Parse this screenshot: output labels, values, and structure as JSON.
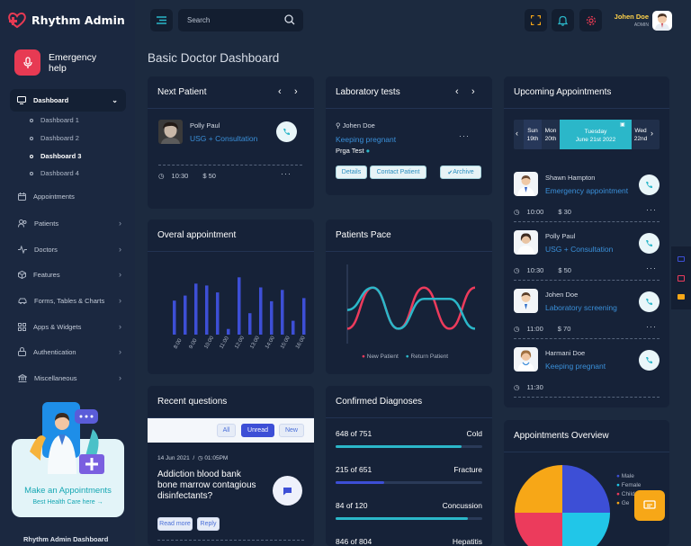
{
  "app": {
    "title": "Rhythm Admin"
  },
  "sidebar": {
    "emergency": "Emergency help",
    "active": "Dashboard",
    "submenu": [
      "Dashboard 1",
      "Dashboard 2",
      "Dashboard 3",
      "Dashboard 4"
    ],
    "active_sub": "Dashboard 3",
    "items": [
      {
        "label": "Appointments",
        "icon": "calendar-icon",
        "chevron": false
      },
      {
        "label": "Patients",
        "icon": "users-icon",
        "chevron": true
      },
      {
        "label": "Doctors",
        "icon": "activity-icon",
        "chevron": true
      },
      {
        "label": "Features",
        "icon": "cube-icon",
        "chevron": true
      },
      {
        "label": "Forms, Tables & Charts",
        "icon": "car-icon",
        "chevron": true
      },
      {
        "label": "Apps & Widgets",
        "icon": "grid-icon",
        "chevron": true
      },
      {
        "label": "Authentication",
        "icon": "lock-icon",
        "chevron": true
      },
      {
        "label": "Miscellaneous",
        "icon": "bank-icon",
        "chevron": true
      }
    ],
    "promo": {
      "title": "Make an Appointments",
      "subtitle": "Best Health Care here →"
    },
    "footer": "Rhythm Admin Dashboard"
  },
  "header": {
    "search_placeholder": "Search",
    "user": {
      "name": "Johen Doe",
      "role": "ADMIN"
    }
  },
  "page": {
    "title": "Basic Doctor Dashboard"
  },
  "next_patient": {
    "title": "Next Patient",
    "name": "Polly Paul",
    "procedure": "USG + Consultation",
    "time": "10:30",
    "fee": "$ 50"
  },
  "lab_tests": {
    "title": "Laboratory tests",
    "doctor": "Johen Doe",
    "subject": "Keeping pregnant",
    "test": "Prga Test",
    "buttons": [
      "Details",
      "Contact Patient",
      "Archive"
    ]
  },
  "upcoming": {
    "title": "Upcoming Appointments",
    "dates": [
      {
        "d": "Sun",
        "n": "19th"
      },
      {
        "d": "Mon",
        "n": "20th"
      },
      {
        "d": "Tuesday",
        "n": "June 21st 2022"
      },
      {
        "d": "Wed",
        "n": "22nd"
      }
    ],
    "items": [
      {
        "name": "Shawn Hampton",
        "proc": "Emergency appointment",
        "time": "10:00",
        "fee": "$ 30"
      },
      {
        "name": "Polly Paul",
        "proc": "USG + Consultation",
        "time": "10:30",
        "fee": "$ 50"
      },
      {
        "name": "Johen Doe",
        "proc": "Laboratory screening",
        "time": "11:00",
        "fee": "$ 70"
      },
      {
        "name": "Harmani Doe",
        "proc": "Keeping pregnant",
        "time": "11:30",
        "fee": ""
      }
    ]
  },
  "overall": {
    "title": "Overal appointment"
  },
  "pace": {
    "title": "Patients Pace",
    "legend": [
      "New Patient",
      "Return Patient"
    ]
  },
  "recent": {
    "title": "Recent questions",
    "filters": [
      "All",
      "Unread",
      "New"
    ],
    "date": "14 Jun 2021",
    "time": "01:05PM",
    "question": "Addiction blood bank bone marrow contagious disinfectants?",
    "actions": [
      "Read more",
      "Reply"
    ]
  },
  "diagnoses": {
    "title": "Confirmed Diagnoses",
    "items": [
      {
        "count": "648 of 751",
        "name": "Cold",
        "pct": 0.86,
        "color": "#2bb7c9"
      },
      {
        "count": "215 of 651",
        "name": "Fracture",
        "pct": 0.33,
        "color": "#3d4fd6"
      },
      {
        "count": "84 of 120",
        "name": "Concussion",
        "pct": 0.9,
        "color": "#2bb7c9"
      },
      {
        "count": "846 of 804",
        "name": "Hepatitis",
        "pct": 0.95,
        "color": "#3d4fd6"
      }
    ]
  },
  "overview": {
    "title": "Appointments Overview",
    "legend": [
      {
        "label": "Male",
        "color": "#3d4fd6"
      },
      {
        "label": "Female",
        "color": "#21c6e8"
      },
      {
        "label": "Child",
        "color": "#ec3b5c"
      },
      {
        "label": "Ge",
        "color": "#f7a717"
      }
    ]
  },
  "chart_data": [
    {
      "type": "bar",
      "title": "Overal appointment",
      "categories": [
        "8:00",
        "9:00",
        "10:00",
        "11:00",
        "12:00",
        "13:00",
        "14:00",
        "15:00",
        "16:00"
      ],
      "series": [
        {
          "values": [
            0.54,
            0.62,
            0.81,
            0.78,
            0.67,
            0.09,
            0.91,
            0.34,
            0.75,
            0.53,
            0.71,
            0.22,
            0.58
          ]
        }
      ],
      "color": "#3d4fd6"
    },
    {
      "type": "line",
      "title": "Patients Pace",
      "series": [
        {
          "name": "New Patient",
          "color": "#ec3b5c",
          "values": [
            0.2,
            0.75,
            0.2,
            0.75,
            0.2,
            0.75
          ]
        },
        {
          "name": "Return Patient",
          "color": "#2bb7c9",
          "values": [
            0.45,
            0.75,
            0.2,
            0.6,
            0.6,
            0.2
          ]
        }
      ]
    }
  ]
}
